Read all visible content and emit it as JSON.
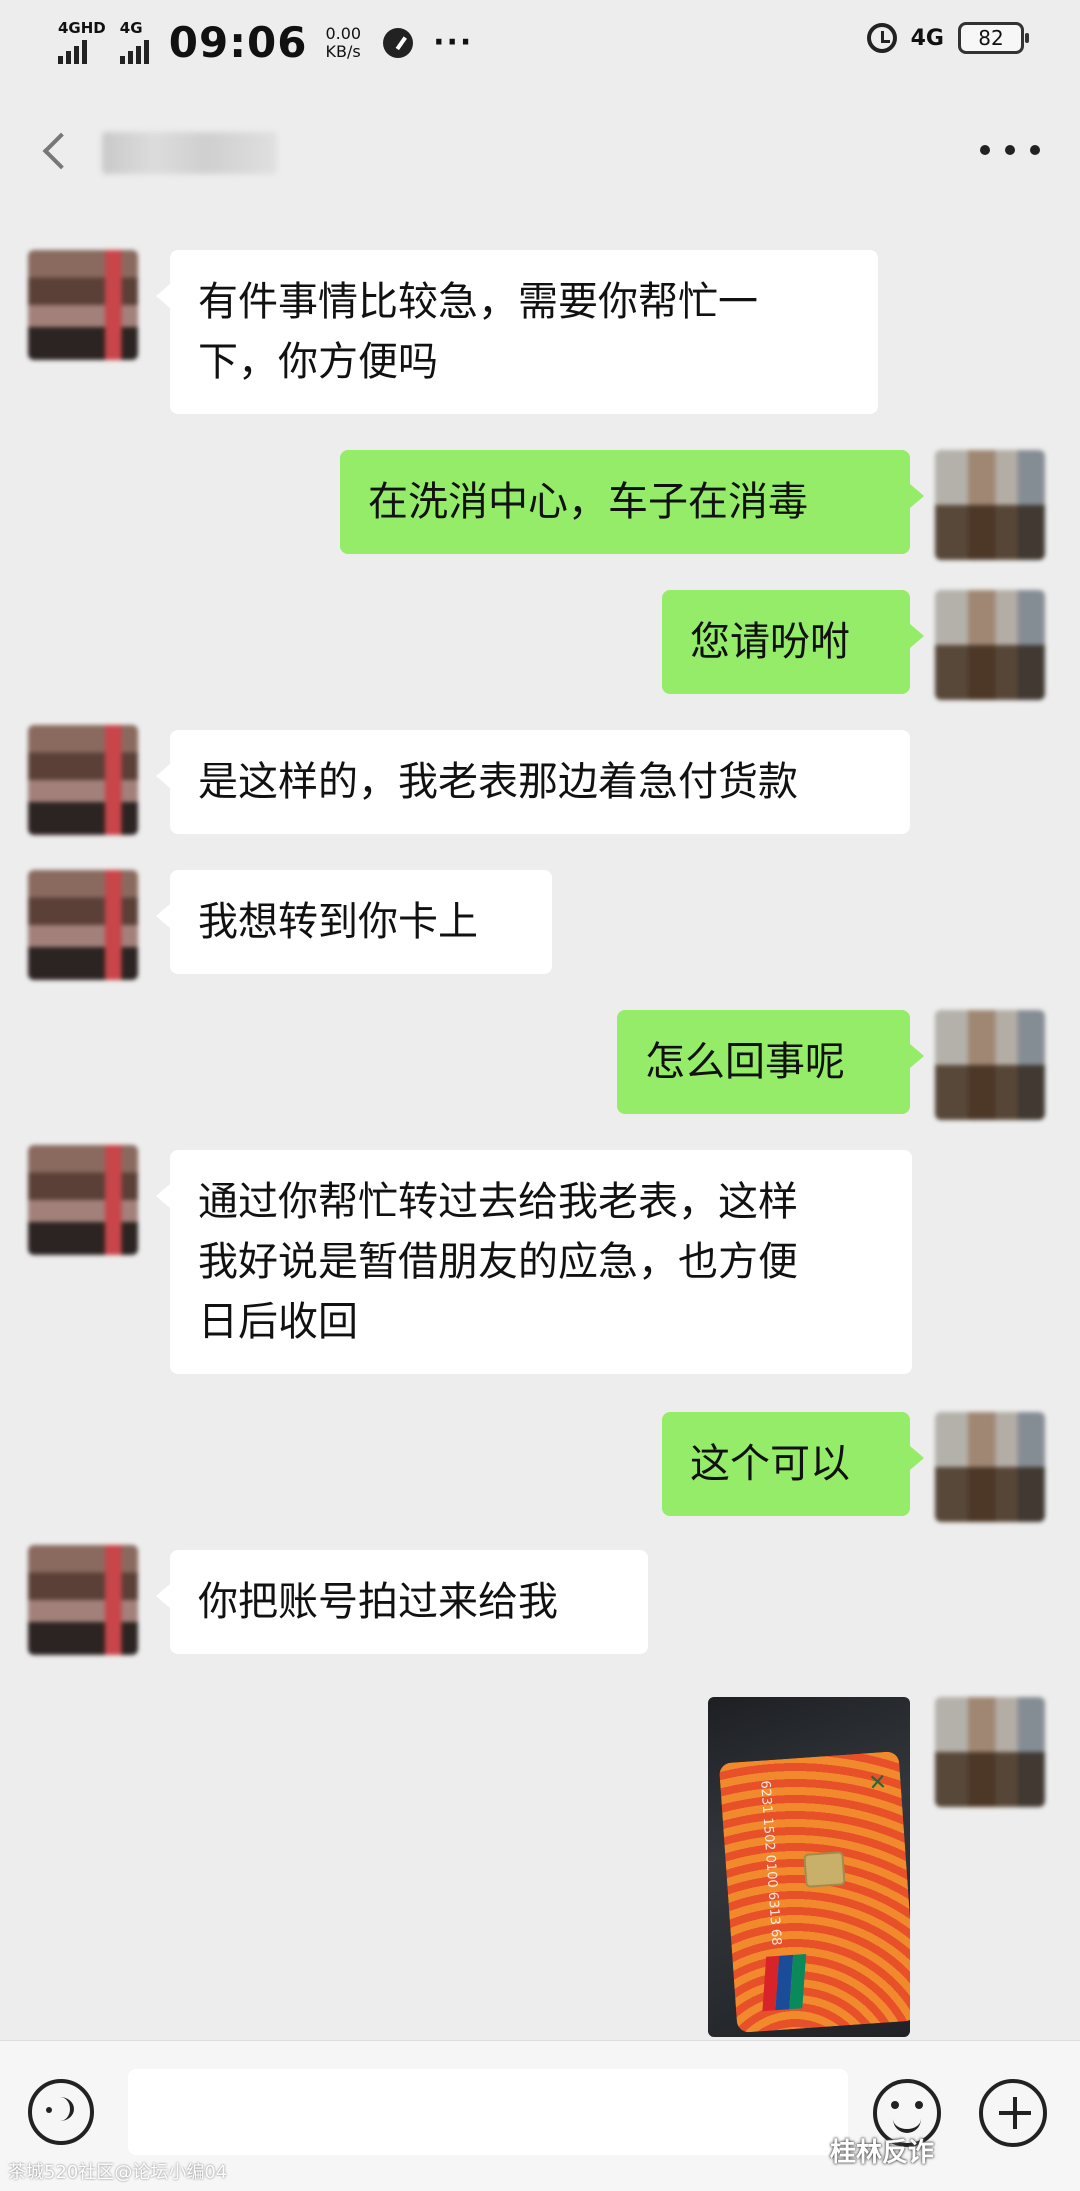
{
  "status_bar": {
    "sim1_label": "4GHD",
    "sim2_label": "4G",
    "time": "09:06",
    "speed_value": "0.00",
    "speed_unit": "KB/s",
    "more": "···",
    "network": "4G",
    "battery": "82"
  },
  "messages": [
    {
      "side": "in",
      "text": "有件事情比较急，需要你帮忙一\n下，你方便吗"
    },
    {
      "side": "out",
      "text": "在洗消中心，车子在消毒"
    },
    {
      "side": "out",
      "text": "您请吩咐"
    },
    {
      "side": "in",
      "text": "是这样的，我老表那边着急付货款"
    },
    {
      "side": "in",
      "text": "我想转到你卡上"
    },
    {
      "side": "out",
      "text": "怎么回事呢"
    },
    {
      "side": "in",
      "text": "通过你帮忙转过去给我老表，这样\n我好说是暂借朋友的应急，也方便\n日后收回"
    },
    {
      "side": "out",
      "text": "这个可以"
    },
    {
      "side": "in",
      "text": "你把账号拍过来给我"
    }
  ],
  "photo_message": {
    "card_number": "6231 1502 0100 6313 68"
  },
  "watermarks": {
    "right": "桂林反诈",
    "left": "茶城520社区@论坛小编04"
  }
}
